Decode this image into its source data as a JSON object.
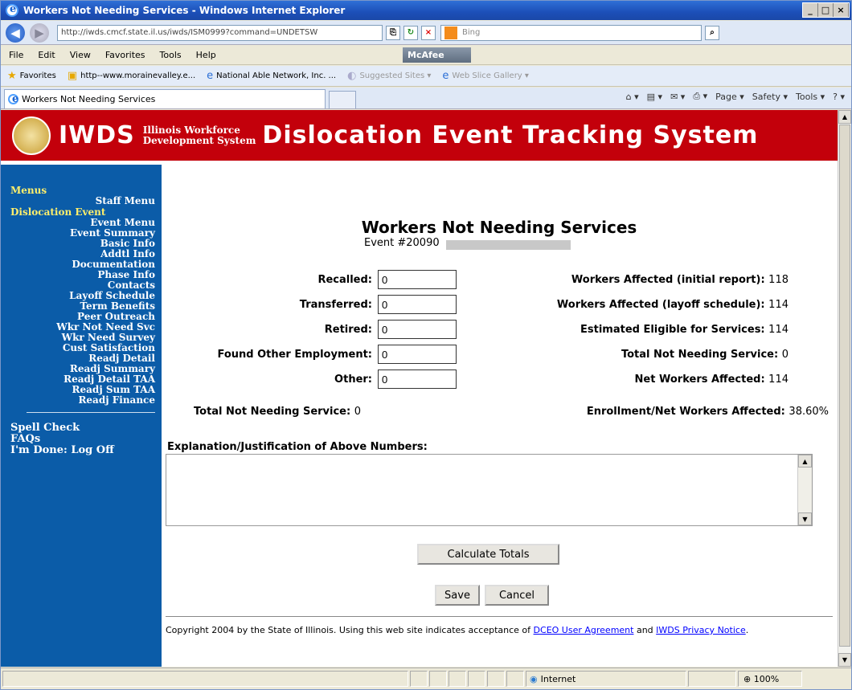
{
  "window": {
    "title": "Workers Not Needing Services - Windows Internet Explorer"
  },
  "address": {
    "url": "http://iwds.cmcf.state.il.us/iwds/ISM0999?command=UNDETSW",
    "search_placeholder": "Bing"
  },
  "menubar": {
    "items": [
      "File",
      "Edit",
      "View",
      "Favorites",
      "Tools",
      "Help"
    ],
    "mcafee": "McAfee"
  },
  "favorites": {
    "label": "Favorites",
    "items": [
      "http--www.morainevalley.e...",
      "National Able Network, Inc. ...",
      "Suggested Sites ▾",
      "Web Slice Gallery ▾"
    ]
  },
  "tab": {
    "title": "Workers Not Needing Services"
  },
  "cmdbar": {
    "page": "Page ▾",
    "safety": "Safety ▾",
    "tools": "Tools ▾"
  },
  "banner": {
    "iwds": "IWDS",
    "sub1": "Illinois Workforce",
    "sub2": "Development System",
    "title": "Dislocation Event Tracking System"
  },
  "sidebar": {
    "menus": "Menus",
    "staff_menu": "Staff Menu",
    "dislocation_event": "Dislocation Event",
    "links": [
      "Event Menu",
      "Event Summary",
      "Basic Info",
      "Addtl Info",
      "Documentation",
      "Phase Info",
      "Contacts",
      "Layoff Schedule",
      "Term Benefits",
      "Peer Outreach",
      "Wkr Not Need Svc",
      "Wkr Need Survey",
      "Cust Satisfaction",
      "Readj Detail",
      "Readj Summary",
      "Readj Detail TAA",
      "Readj Sum TAA",
      "Readj Finance"
    ],
    "bottom": [
      "Spell Check",
      "FAQs",
      "I'm Done: Log Off"
    ]
  },
  "page": {
    "title": "Workers Not Needing Services",
    "event": "Event #20090",
    "fields": [
      {
        "label": "Recalled:",
        "value": "0"
      },
      {
        "label": "Transferred:",
        "value": "0"
      },
      {
        "label": "Retired:",
        "value": "0"
      },
      {
        "label": "Found Other Employment:",
        "value": "0"
      },
      {
        "label": "Other:",
        "value": "0"
      }
    ],
    "stats": [
      {
        "label": "Workers Affected (initial report):",
        "value": "118"
      },
      {
        "label": "Workers Affected (layoff schedule):",
        "value": "114"
      },
      {
        "label": "Estimated Eligible for Services:",
        "value": "114"
      },
      {
        "label": "Total Not Needing Service:",
        "value": "0"
      },
      {
        "label": "Net Workers Affected:",
        "value": "114"
      }
    ],
    "total_label": "Total Not Needing Service:",
    "total_value": "0",
    "enroll_label": "Enrollment/Net Workers Affected:",
    "enroll_value": "38.60%",
    "explanation_label": "Explanation/Justification of Above Numbers:",
    "calc_button": "Calculate Totals",
    "save_button": "Save",
    "cancel_button": "Cancel",
    "copyright_pre": "Copyright 2004 by the State of Illinois. Using this web site indicates acceptance of",
    "agreement_link": "DCEO User Agreement",
    "and": "and",
    "privacy_link": "IWDS Privacy Notice",
    "period": "."
  },
  "status": {
    "zone": "Internet",
    "zoom": "100%"
  }
}
